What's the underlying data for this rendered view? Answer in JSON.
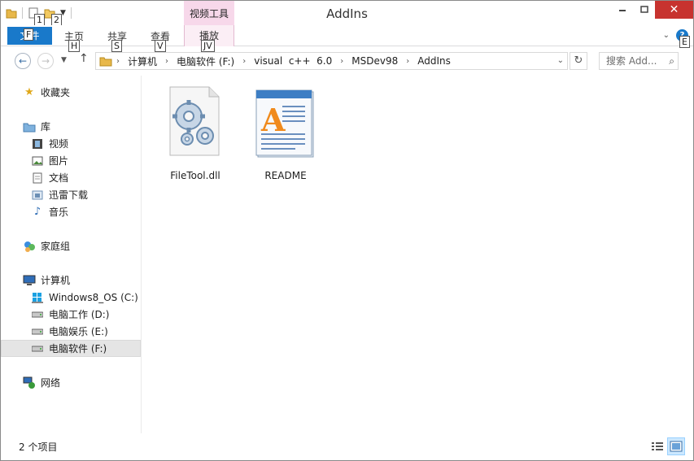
{
  "window": {
    "title": "AddIns"
  },
  "quick_access": {
    "keytip_1": "1",
    "keytip_2": "2"
  },
  "context_tab": {
    "label": "视频工具"
  },
  "ribbon": {
    "tabs": [
      {
        "label": "文件",
        "keytip": "F"
      },
      {
        "label": "主页",
        "keytip": "H"
      },
      {
        "label": "共享",
        "keytip": "S"
      },
      {
        "label": "查看",
        "keytip": "V"
      },
      {
        "label": "播放",
        "keytip": "JV"
      }
    ],
    "help_keytip": "E"
  },
  "address": {
    "crumbs": [
      "计算机",
      "电脑软件 (F:)",
      "visual  c++  6.0",
      "MSDev98",
      "AddIns"
    ]
  },
  "search": {
    "placeholder": "搜索 Add..."
  },
  "navpane": {
    "favorites": "收藏夹",
    "libraries": "库",
    "lib_items": [
      "视频",
      "图片",
      "文档",
      "迅雷下载",
      "音乐"
    ],
    "homegroup": "家庭组",
    "computer": "计算机",
    "drives": [
      "Windows8_OS (C:)",
      "电脑工作 (D:)",
      "电脑娱乐 (E:)",
      "电脑软件 (F:)"
    ],
    "network": "网络"
  },
  "files": [
    {
      "name": "FileTool.dll",
      "icon": "dll-gear-icon"
    },
    {
      "name": "README",
      "icon": "wordpad-document-icon"
    }
  ],
  "status": {
    "count_text": "2 个项目"
  },
  "colors": {
    "file_tab": "#1979ca",
    "context_tab": "#f7d8ea",
    "close_button": "#c7332f"
  }
}
